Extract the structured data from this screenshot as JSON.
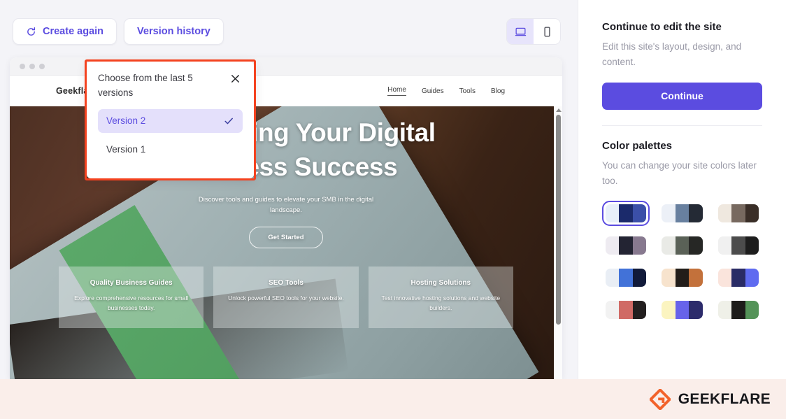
{
  "toolbar": {
    "create_again_label": "Create again",
    "version_history_label": "Version history",
    "refresh_icon": "refresh-icon",
    "desktop_icon": "desktop-monitor-icon",
    "mobile_icon": "mobile-phone-icon",
    "active_device": "desktop"
  },
  "version_popup": {
    "title": "Choose from the last 5 versions",
    "close_icon": "close-x-icon",
    "check_icon": "checkmark-icon",
    "items": [
      {
        "label": "Version 2",
        "selected": true
      },
      {
        "label": "Version 1",
        "selected": false
      }
    ]
  },
  "preview": {
    "site": {
      "logo": "Geekflare",
      "nav": [
        {
          "label": "Home",
          "active": true
        },
        {
          "label": "Guides",
          "active": false
        },
        {
          "label": "Tools",
          "active": false
        },
        {
          "label": "Blog",
          "active": false
        }
      ],
      "hero_title": "Empowering Your Digital Business Success",
      "hero_subtitle": "Discover tools and guides to elevate your SMB in the digital landscape.",
      "cta_label": "Get Started",
      "cards": [
        {
          "title": "Quality Business Guides",
          "text": "Explore comprehensive resources for small businesses today."
        },
        {
          "title": "SEO Tools",
          "text": "Unlock powerful SEO tools for your website."
        },
        {
          "title": "Hosting Solutions",
          "text": "Test innovative hosting solutions and website builders."
        }
      ]
    }
  },
  "sidebar": {
    "continue_heading": "Continue to edit the site",
    "continue_desc": "Edit this site's layout, design, and content.",
    "continue_button": "Continue",
    "palettes_heading": "Color palettes",
    "palettes_desc": "You can change your site colors later too.",
    "accent_color": "#5b4ce0",
    "palettes": [
      {
        "colors": [
          "#e8f0fa",
          "#1b2a6b",
          "#3b4fa8"
        ],
        "selected": true
      },
      {
        "colors": [
          "#ecf0f7",
          "#68809f",
          "#242a35"
        ],
        "selected": false
      },
      {
        "colors": [
          "#efe8df",
          "#77695f",
          "#3a2e27"
        ],
        "selected": false
      },
      {
        "colors": [
          "#eeebf1",
          "#232433",
          "#87798f"
        ],
        "selected": false
      },
      {
        "colors": [
          "#e9eae6",
          "#5a6157",
          "#262725"
        ],
        "selected": false
      },
      {
        "colors": [
          "#f0f0f0",
          "#4c4c4c",
          "#1d1d1d"
        ],
        "selected": false
      },
      {
        "colors": [
          "#e9eef5",
          "#4272d8",
          "#111a3a"
        ],
        "selected": false
      },
      {
        "colors": [
          "#f7e3cd",
          "#221d19",
          "#c3713b"
        ],
        "selected": false
      },
      {
        "colors": [
          "#fae4dc",
          "#2a2c66",
          "#5f6bf0"
        ],
        "selected": false
      },
      {
        "colors": [
          "#f2f2f2",
          "#d06a65",
          "#231f1f"
        ],
        "selected": false
      },
      {
        "colors": [
          "#fbf4c0",
          "#6763ea",
          "#2c2b6b"
        ],
        "selected": false
      },
      {
        "colors": [
          "#eff0e8",
          "#1d1c1a",
          "#549358"
        ],
        "selected": false
      }
    ]
  },
  "footer": {
    "brand": "GEEKFLARE",
    "logo_icon": "geekflare-diamond-icon",
    "logo_color": "#f2622a",
    "background": "#faeeea"
  }
}
